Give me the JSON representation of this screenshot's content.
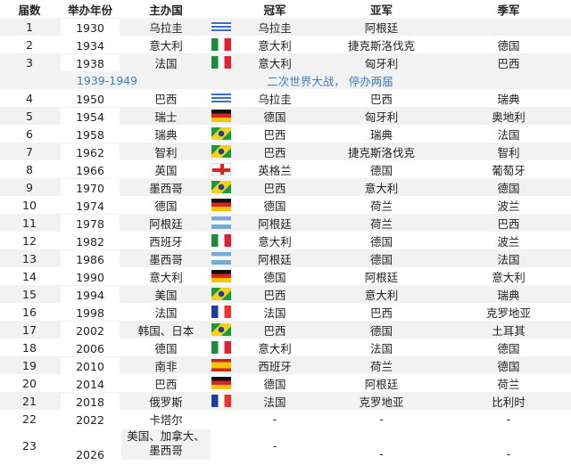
{
  "headers": [
    "届数",
    "举办年份",
    "主办国",
    "冠军",
    "亚军",
    "季军"
  ],
  "war": {
    "years": "1939-1949",
    "note": "二次世界大战， 停办两届"
  },
  "rows": [
    {
      "n": "1",
      "year": "1930",
      "host": "乌拉圭",
      "flag": "uruguay",
      "champ": "乌拉圭",
      "runner": "阿根廷",
      "third": ""
    },
    {
      "n": "2",
      "year": "1934",
      "host": "意大利",
      "flag": "italy",
      "champ": "意大利",
      "runner": "捷克斯洛伐克",
      "third": "德国"
    },
    {
      "n": "3",
      "year": "1938",
      "host": "法国",
      "flag": "italy",
      "champ": "意大利",
      "runner": "匈牙利",
      "third": "巴西"
    },
    {
      "n": "4",
      "year": "1950",
      "host": "巴西",
      "flag": "uruguay",
      "champ": "乌拉圭",
      "runner": "巴西",
      "third": "瑞典"
    },
    {
      "n": "5",
      "year": "1954",
      "host": "瑞士",
      "flag": "germany",
      "champ": "德国",
      "runner": "匈牙利",
      "third": "奥地利"
    },
    {
      "n": "6",
      "year": "1958",
      "host": "瑞典",
      "flag": "brazil",
      "champ": "巴西",
      "runner": "瑞典",
      "third": "法国"
    },
    {
      "n": "7",
      "year": "1962",
      "host": "智利",
      "flag": "brazil",
      "champ": "巴西",
      "runner": "捷克斯洛伐克",
      "third": "智利"
    },
    {
      "n": "8",
      "year": "1966",
      "host": "英国",
      "flag": "england",
      "champ": "英格兰",
      "runner": "德国",
      "third": "葡萄牙"
    },
    {
      "n": "9",
      "year": "1970",
      "host": "墨西哥",
      "flag": "brazil",
      "champ": "巴西",
      "runner": "意大利",
      "third": "德国"
    },
    {
      "n": "10",
      "year": "1974",
      "host": "德国",
      "flag": "germany",
      "champ": "德国",
      "runner": "荷兰",
      "third": "波兰"
    },
    {
      "n": "11",
      "year": "1978",
      "host": "阿根廷",
      "flag": "argentina",
      "champ": "阿根廷",
      "runner": "荷兰",
      "third": "巴西"
    },
    {
      "n": "12",
      "year": "1982",
      "host": "西班牙",
      "flag": "italy",
      "champ": "意大利",
      "runner": "德国",
      "third": "波兰"
    },
    {
      "n": "13",
      "year": "1986",
      "host": "墨西哥",
      "flag": "argentina",
      "champ": "阿根廷",
      "runner": "德国",
      "third": "法国"
    },
    {
      "n": "14",
      "year": "1990",
      "host": "意大利",
      "flag": "germany",
      "champ": "德国",
      "runner": "阿根廷",
      "third": "意大利"
    },
    {
      "n": "15",
      "year": "1994",
      "host": "美国",
      "flag": "brazil",
      "champ": "巴西",
      "runner": "意大利",
      "third": "瑞典"
    },
    {
      "n": "16",
      "year": "1998",
      "host": "法国",
      "flag": "france",
      "champ": "法国",
      "runner": "巴西",
      "third": "克罗地亚"
    },
    {
      "n": "17",
      "year": "2002",
      "host": "韩国、日本",
      "flag": "brazil",
      "champ": "巴西",
      "runner": "德国",
      "third": "土耳其"
    },
    {
      "n": "18",
      "year": "2006",
      "host": "德国",
      "flag": "italy",
      "champ": "意大利",
      "runner": "法国",
      "third": "德国"
    },
    {
      "n": "19",
      "year": "2010",
      "host": "南非",
      "flag": "spain",
      "champ": "西班牙",
      "runner": "荷兰",
      "third": "德国"
    },
    {
      "n": "20",
      "year": "2014",
      "host": "巴西",
      "flag": "germany",
      "champ": "德国",
      "runner": "阿根廷",
      "third": "荷兰"
    },
    {
      "n": "21",
      "year": "2018",
      "host": "俄罗斯",
      "flag": "france",
      "champ": "法国",
      "runner": "克罗地亚",
      "third": "比利时"
    },
    {
      "n": "22",
      "year": "2022",
      "host": "卡塔尔",
      "flag": "",
      "champ": "-",
      "runner": "-",
      "third": "-"
    }
  ],
  "last": {
    "n": "23",
    "year": "2026",
    "host1": "美国、加拿大、",
    "host2": "墨西哥",
    "champ": "-",
    "runner": "-",
    "third": "-"
  }
}
